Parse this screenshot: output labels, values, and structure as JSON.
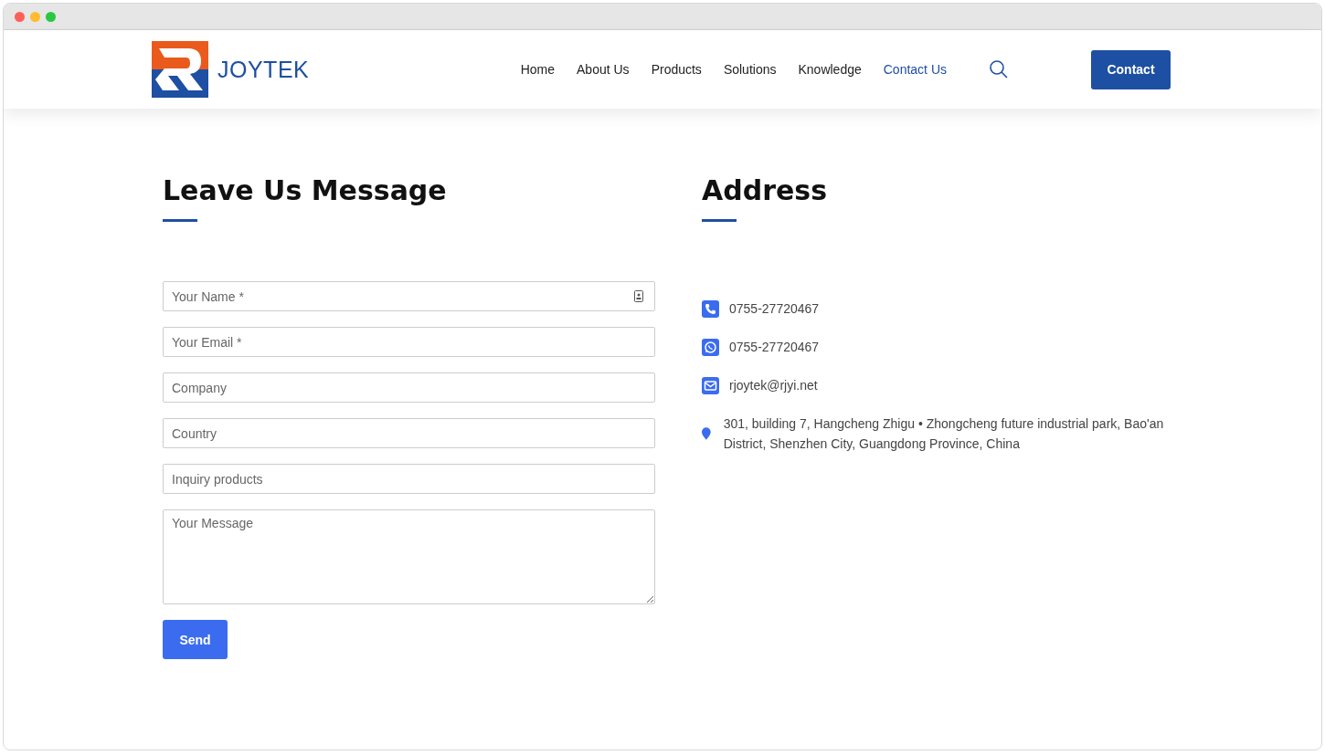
{
  "header": {
    "logo_text": "JOYTEK",
    "nav": [
      {
        "label": "Home",
        "selected": false
      },
      {
        "label": "About Us",
        "selected": false
      },
      {
        "label": "Products",
        "selected": false
      },
      {
        "label": "Solutions",
        "selected": false
      },
      {
        "label": "Knowledge",
        "selected": false
      },
      {
        "label": "Contact Us",
        "selected": true
      }
    ],
    "button": "Contact"
  },
  "form": {
    "title": "Leave Us Message",
    "fields": [
      {
        "kind": "text-icon",
        "placeholder": "Your Name *"
      },
      {
        "kind": "text",
        "placeholder": "Your Email *"
      },
      {
        "kind": "text",
        "placeholder": "Company"
      },
      {
        "kind": "text",
        "placeholder": "Country"
      },
      {
        "kind": "text",
        "placeholder": "Inquiry products"
      },
      {
        "kind": "textarea",
        "placeholder": "Your Message"
      }
    ],
    "submit": "Send"
  },
  "address": {
    "title": "Address",
    "items": [
      {
        "kind": "phone",
        "text": "0755-27720467"
      },
      {
        "kind": "whatsapp",
        "text": "0755-27720467"
      },
      {
        "kind": "email",
        "text": "rjoytek@rjyi.net"
      },
      {
        "kind": "location",
        "text": "301, building 7, Hangcheng Zhigu • Zhongcheng future industrial park, Bao'an District, Shenzhen City, Guangdong Province, China"
      }
    ]
  }
}
